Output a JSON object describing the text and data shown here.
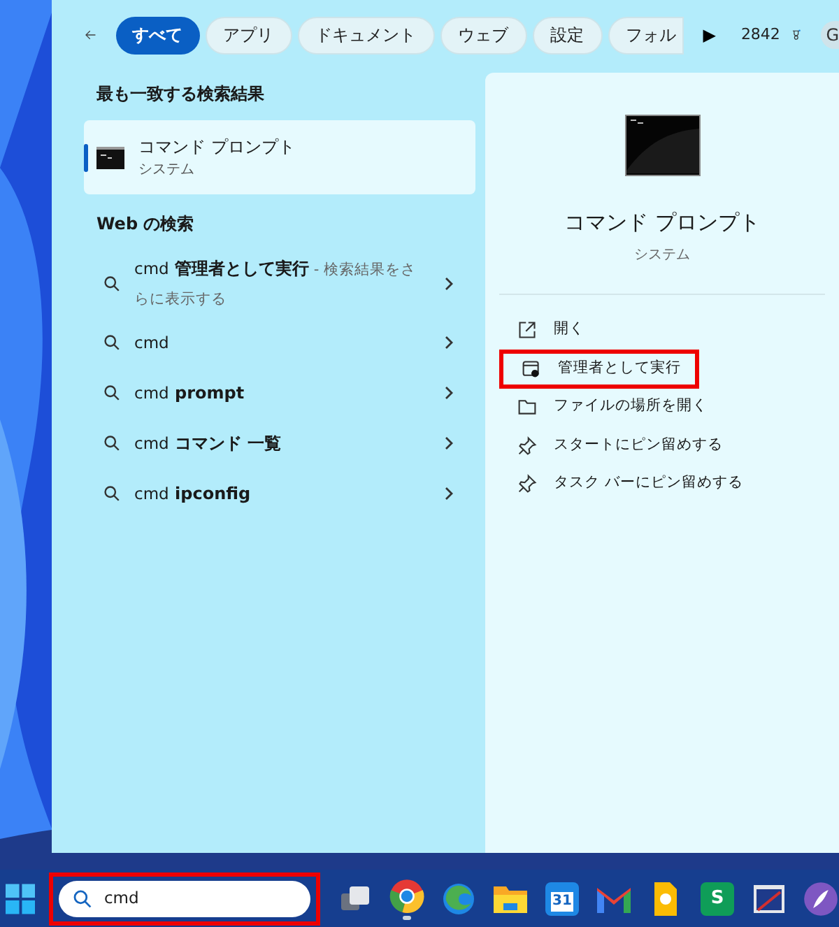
{
  "filters": [
    {
      "label": "すべて",
      "selected": true
    },
    {
      "label": "アプリ",
      "selected": false
    },
    {
      "label": "ドキュメント",
      "selected": false
    },
    {
      "label": "ウェブ",
      "selected": false
    },
    {
      "label": "設定",
      "selected": false
    },
    {
      "label": "フォル",
      "selected": false
    }
  ],
  "more_filters": "▶",
  "points": "2842",
  "avatar": "G",
  "best_match": {
    "heading": "最も一致する検索結果",
    "title": "コマンド プロンプト",
    "subtitle": "システム",
    "selected": true
  },
  "web": {
    "heading": "Web の検索",
    "results": [
      {
        "query": "cmd",
        "suggestion": "管理者として実行",
        "note": "- 検索結果をさらに表示する"
      },
      {
        "query": "cmd"
      },
      {
        "query": "cmd",
        "suggestion": "prompt"
      },
      {
        "query": "cmd",
        "suggestion": "コマンド 一覧"
      },
      {
        "query": "cmd",
        "suggestion": "ipconfig"
      }
    ]
  },
  "detail": {
    "title": "コマンド プロンプト",
    "subtitle": "システム",
    "actions": [
      {
        "kind": "open",
        "label": "開く",
        "highlighted": false
      },
      {
        "kind": "admin",
        "label": "管理者として実行",
        "highlighted": true
      },
      {
        "kind": "folder",
        "label": "ファイルの場所を開く",
        "highlighted": false
      },
      {
        "kind": "pin",
        "label": "スタートにピン留めする",
        "highlighted": false
      },
      {
        "kind": "pin",
        "label": "タスク バーにピン留めする",
        "highlighted": false
      }
    ]
  },
  "taskbar": {
    "search": {
      "value": "cmd",
      "highlighted": true
    },
    "apps": [
      {
        "kind": "taskview"
      },
      {
        "kind": "chrome",
        "running": true
      },
      {
        "kind": "edge"
      },
      {
        "kind": "folder"
      },
      {
        "kind": "calendar",
        "text": "31"
      },
      {
        "kind": "mail"
      },
      {
        "kind": "keep"
      },
      {
        "kind": "sheets",
        "text": "S"
      },
      {
        "kind": "tool"
      },
      {
        "kind": "purple"
      }
    ]
  }
}
